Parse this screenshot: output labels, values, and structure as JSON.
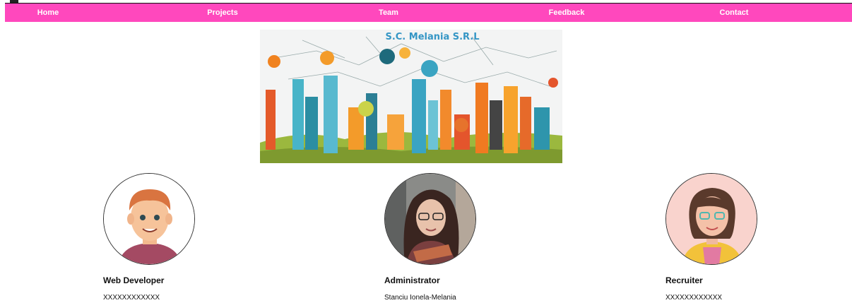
{
  "nav": {
    "items": [
      {
        "label": "Home"
      },
      {
        "label": "Projects"
      },
      {
        "label": "Team"
      },
      {
        "label": "Feedback"
      },
      {
        "label": "Contact"
      }
    ]
  },
  "banner": {
    "title": "S.C. Melania S.R.L"
  },
  "team": [
    {
      "role": "Web Developer",
      "name": "XXXXXXXXXXXX"
    },
    {
      "role": "Administrator",
      "name": "Stanciu Ionela-Melania"
    },
    {
      "role": "Recruiter",
      "name": "XXXXXXXXXXXX"
    }
  ],
  "colors": {
    "navbar": "#ff48bd",
    "nav_text": "#ffffff",
    "banner_title": "#3596c5"
  }
}
